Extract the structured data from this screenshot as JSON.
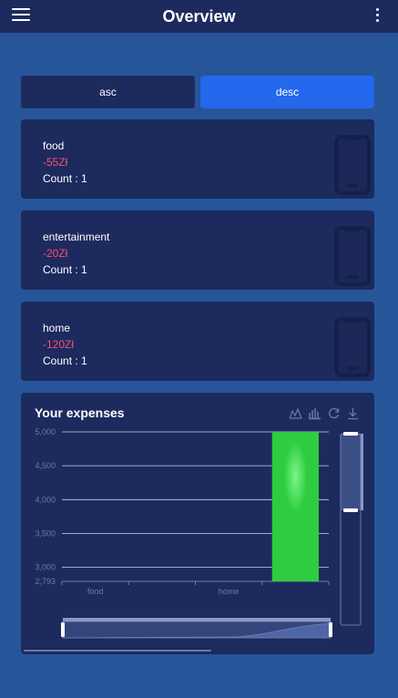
{
  "header": {
    "title": "Overview",
    "menu_icon": "hamburger-menu-icon",
    "more_icon": "more-vertical-icon"
  },
  "sort": {
    "asc_label": "asc",
    "desc_label": "desc",
    "selected": "desc"
  },
  "expenses": [
    {
      "category": "food",
      "amount": "-55Zł",
      "count": "Count : 1",
      "icon": "smartphone-icon"
    },
    {
      "category": "entertainment",
      "amount": "-20Zł",
      "count": "Count : 1",
      "icon": "smartphone-icon"
    },
    {
      "category": "home",
      "amount": "-120Zł",
      "count": "Count : 1",
      "icon": "smartphone-icon"
    }
  ],
  "chart": {
    "title": "Your expenses",
    "toolbox": [
      "line-chart-icon",
      "bar-chart-icon",
      "restore-icon",
      "download-icon"
    ]
  },
  "chart_data": {
    "type": "bar",
    "categories": [
      "food",
      "",
      "home",
      ""
    ],
    "xtick_labels": [
      "food",
      "home"
    ],
    "values": [
      null,
      null,
      null,
      5000
    ],
    "y_ticks": [
      "2,793",
      "3,000",
      "3,500",
      "4,000",
      "4,500",
      "5,000"
    ],
    "ylim": [
      2793,
      5000
    ],
    "bar_color": "#2ecc40",
    "grid": true,
    "legend": "none",
    "dataZoom": {
      "x_slider": true,
      "y_slider": true,
      "y_zoom_range": [
        0.6,
        1.0
      ]
    }
  },
  "colors": {
    "background": "#27559a",
    "card": "#1c2a5e",
    "accent": "#2468ee",
    "negative": "#ff4d6a"
  }
}
